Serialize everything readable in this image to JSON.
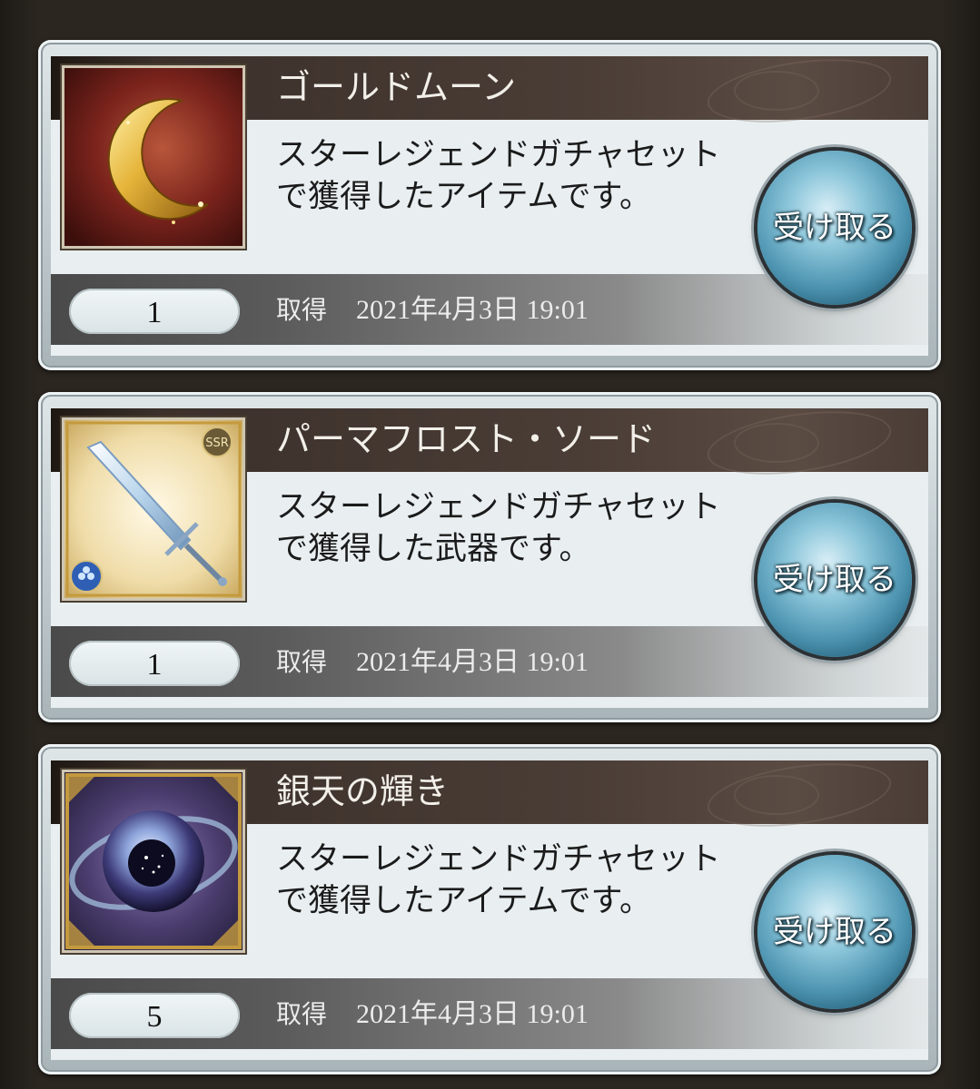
{
  "items": [
    {
      "name": "ゴールドムーン",
      "description": "スターレジェンドガチャセットで獲得したアイテムです。",
      "quantity": "1",
      "acquired_label": "取得",
      "acquired_date": "2021年4月3日 19:01",
      "receive_label": "受け取る",
      "icon": "gold-moon-icon"
    },
    {
      "name": "パーマフロスト・ソード",
      "description": "スターレジェンドガチャセットで獲得した武器です。",
      "quantity": "1",
      "acquired_label": "取得",
      "acquired_date": "2021年4月3日 19:01",
      "receive_label": "受け取る",
      "icon": "permafrost-sword-icon",
      "rarity": "SSR"
    },
    {
      "name": "銀天の輝き",
      "description": "スターレジェンドガチャセットで獲得したアイテムです。",
      "quantity": "5",
      "acquired_label": "取得",
      "acquired_date": "2021年4月3日 19:01",
      "receive_label": "受け取る",
      "icon": "silver-sky-orb-icon"
    }
  ]
}
